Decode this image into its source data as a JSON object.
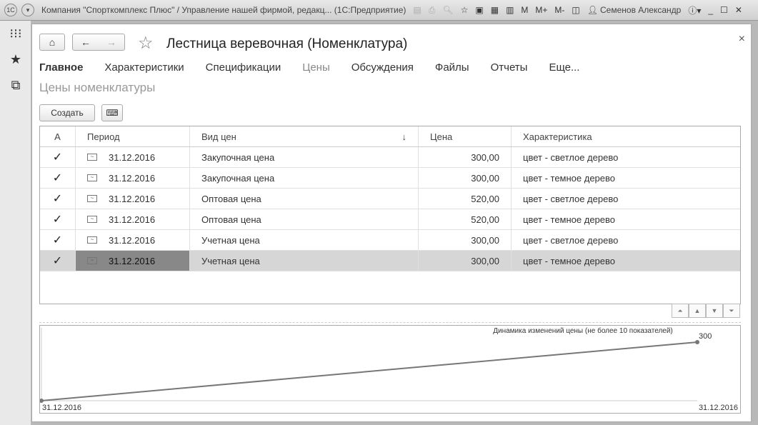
{
  "titlebar": {
    "title": "Компания \"Спорткомплекс Плюс\" / Управление нашей фирмой, редакц... (1С:Предприятие)",
    "m": "M",
    "mplus": "M+",
    "mminus": "M-",
    "user": "Семенов Александр"
  },
  "form": {
    "title": "Лестница веревочная (Номенклатура)",
    "section": "Цены номенклатуры",
    "create": "Создать"
  },
  "tabs": [
    {
      "label": "Главное"
    },
    {
      "label": "Характеристики"
    },
    {
      "label": "Спецификации"
    },
    {
      "label": "Цены"
    },
    {
      "label": "Обсуждения"
    },
    {
      "label": "Файлы"
    },
    {
      "label": "Отчеты"
    },
    {
      "label": "Еще..."
    }
  ],
  "table": {
    "headers": [
      "А",
      "Период",
      "Вид цен",
      "Цена",
      "Характеристика"
    ],
    "sort_icon": "↓",
    "rows": [
      {
        "period": "31.12.2016",
        "type": "Закупочная цена",
        "price": "300,00",
        "char": "цвет - светлое дерево"
      },
      {
        "period": "31.12.2016",
        "type": "Закупочная цена",
        "price": "300,00",
        "char": "цвет - темное дерево"
      },
      {
        "period": "31.12.2016",
        "type": "Оптовая цена",
        "price": "520,00",
        "char": "цвет - светлое дерево"
      },
      {
        "period": "31.12.2016",
        "type": "Оптовая цена",
        "price": "520,00",
        "char": "цвет - темное дерево"
      },
      {
        "period": "31.12.2016",
        "type": "Учетная цена",
        "price": "300,00",
        "char": "цвет - светлое дерево"
      },
      {
        "period": "31.12.2016",
        "type": "Учетная цена",
        "price": "300,00",
        "char": "цвет - темное дерево"
      }
    ]
  },
  "chart_data": {
    "type": "line",
    "title": "Динамика изменений цены (не более 10 показателей)",
    "x": [
      "31.12.2016",
      "31.12.2016"
    ],
    "values": [
      0,
      300
    ],
    "point_labels": [
      "",
      "300"
    ],
    "ylim": [
      0,
      300
    ],
    "color": "#777777"
  }
}
